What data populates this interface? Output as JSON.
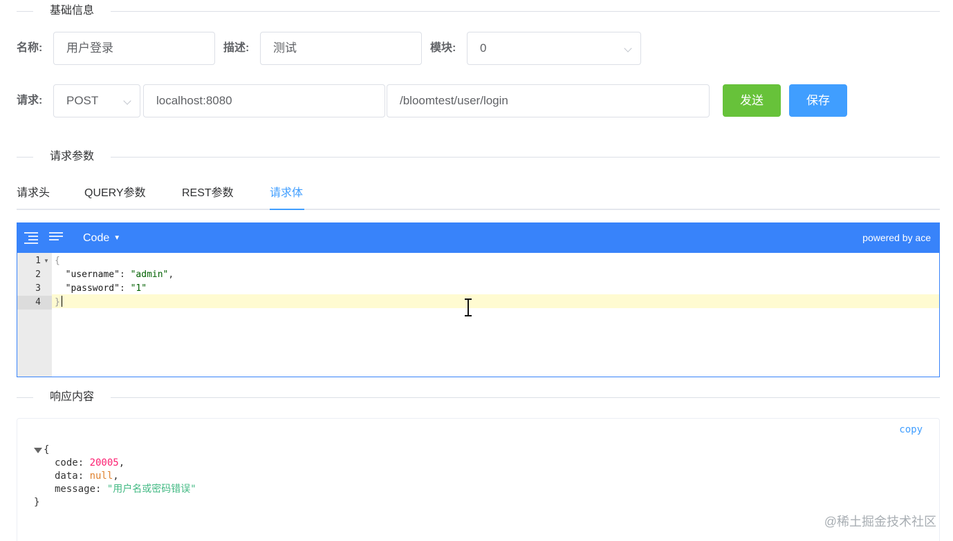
{
  "sections": {
    "basic_info": "基础信息",
    "request_params": "请求参数",
    "response": "响应内容"
  },
  "form": {
    "name_label": "名称:",
    "name_value": "用户登录",
    "desc_label": "描述:",
    "desc_value": "测试",
    "module_label": "模块:",
    "module_value": "0",
    "request_label": "请求:",
    "method_value": "POST",
    "host_value": "localhost:8080",
    "path_value": "/bloomtest/user/login",
    "send_label": "发送",
    "save_label": "保存"
  },
  "tabs": [
    {
      "label": "请求头",
      "active": false
    },
    {
      "label": "QUERY参数",
      "active": false
    },
    {
      "label": "REST参数",
      "active": false
    },
    {
      "label": "请求体",
      "active": true
    }
  ],
  "editor": {
    "mode_label": "Code",
    "powered_by": "powered by ace",
    "line_numbers": [
      "1",
      "2",
      "3",
      "4"
    ],
    "lines": {
      "open_brace": "{",
      "username_key": "\"username\"",
      "username_value": "\"admin\"",
      "password_key": "\"password\"",
      "password_value": "\"1\"",
      "close_brace": "}"
    }
  },
  "response": {
    "copy_label": "copy",
    "open_brace": "{",
    "close_brace": "}",
    "fields": {
      "code_key": "code",
      "code_value": "20005",
      "data_key": "data",
      "data_value": "null",
      "message_key": "message",
      "message_value": "\"用户名或密码错误\""
    }
  },
  "watermark": "@稀土掘金技术社区",
  "colors": {
    "send_button": "#67c23a",
    "save_button": "#409eff",
    "editor_bar": "#3883fa",
    "active_tab": "#409eff"
  }
}
